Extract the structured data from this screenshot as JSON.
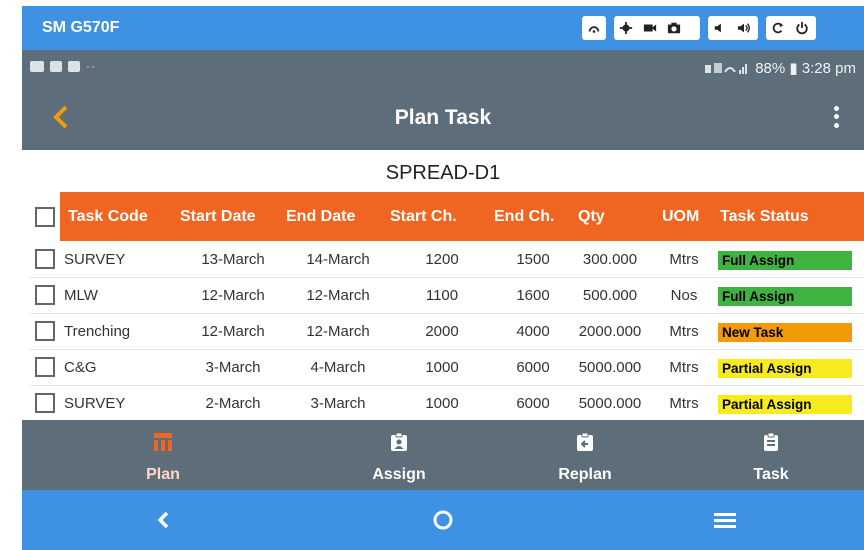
{
  "device": {
    "name": "SM G570F",
    "tool_icons": [
      "cast-icon",
      "settings-icon",
      "video-icon",
      "camera-icon",
      "volume-down-icon",
      "volume-up-icon",
      "rotate-icon",
      "power-icon"
    ]
  },
  "status": {
    "battery": "88%",
    "time": "3:28 pm",
    "text": "88% ▮ 3:28 pm"
  },
  "app_bar": {
    "title": "Plan Task"
  },
  "spread": "SPREAD-D1",
  "table": {
    "headers": [
      "Task Code",
      "Start Date",
      "End  Date",
      "Start  Ch.",
      "End Ch.",
      "Qty",
      "UOM",
      "Task  Status"
    ],
    "rows": [
      {
        "code": "SURVEY",
        "start": "13-March",
        "end": "14-March",
        "start_ch": "1200",
        "end_ch": "1500",
        "qty": "300.000",
        "uom": "Mtrs",
        "status": "Full Assign",
        "status_color": "#3fb33f"
      },
      {
        "code": "MLW",
        "start": "12-March",
        "end": "12-March",
        "start_ch": "1100",
        "end_ch": "1600",
        "qty": "500.000",
        "uom": "Nos",
        "status": "Full Assign",
        "status_color": "#3fb33f"
      },
      {
        "code": "Trenching",
        "start": "12-March",
        "end": "12-March",
        "start_ch": "2000",
        "end_ch": "4000",
        "qty": "2000.000",
        "uom": "Mtrs",
        "status": "New Task",
        "status_color": "#f29a07"
      },
      {
        "code": "C&G",
        "start": "3-March",
        "end": "4-March",
        "start_ch": "1000",
        "end_ch": "6000",
        "qty": "5000.000",
        "uom": "Mtrs",
        "status": "Partial Assign",
        "status_color": "#f7eb1e"
      },
      {
        "code": "SURVEY",
        "start": "2-March",
        "end": "3-March",
        "start_ch": "1000",
        "end_ch": "6000",
        "qty": "5000.000",
        "uom": "Mtrs",
        "status": "Partial Assign",
        "status_color": "#f7eb1e"
      }
    ]
  },
  "tabs": [
    {
      "label": "Plan",
      "icon": "plan-icon",
      "active": true
    },
    {
      "label": "Assign",
      "icon": "assign-icon",
      "active": false
    },
    {
      "label": "Replan",
      "icon": "replan-icon",
      "active": false
    },
    {
      "label": "Task",
      "icon": "task-icon",
      "active": false
    }
  ],
  "colors": {
    "accent_blue": "#3f92e3",
    "app_bar": "#5d6d79",
    "header_orange": "#f16522",
    "active_tab": "#f16522"
  }
}
